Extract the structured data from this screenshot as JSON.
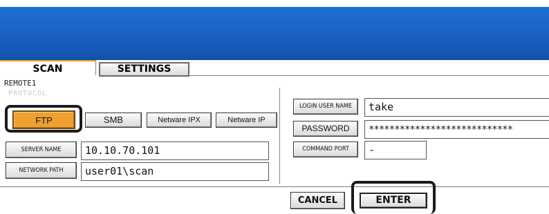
{
  "tabs": {
    "scan": "SCAN",
    "settings": "SETTINGS"
  },
  "remote_label": "REMOTE1",
  "protocol_heading": "PROTOCOL",
  "protocols": {
    "ftp": "FTP",
    "smb": "SMB",
    "netware_ipx": "Netware IPX",
    "netware_ip": "Netware IP"
  },
  "selected_protocol": "FTP",
  "server": {
    "label": "SERVER NAME",
    "value": "10.10.70.101"
  },
  "network_path": {
    "label": "NETWORK PATH",
    "value": "user01\\scan"
  },
  "login": {
    "label": "LOGIN USER NAME",
    "value": "take"
  },
  "password": {
    "label": "PASSWORD",
    "value": "****************************"
  },
  "command_port": {
    "label": "COMMAND PORT",
    "value": "-"
  },
  "actions": {
    "cancel": "CANCEL",
    "enter": "ENTER"
  },
  "colors": {
    "header_blue": "#1a5fc2",
    "selected_orange": "#f0a030",
    "tab_accent": "#f0a020"
  }
}
